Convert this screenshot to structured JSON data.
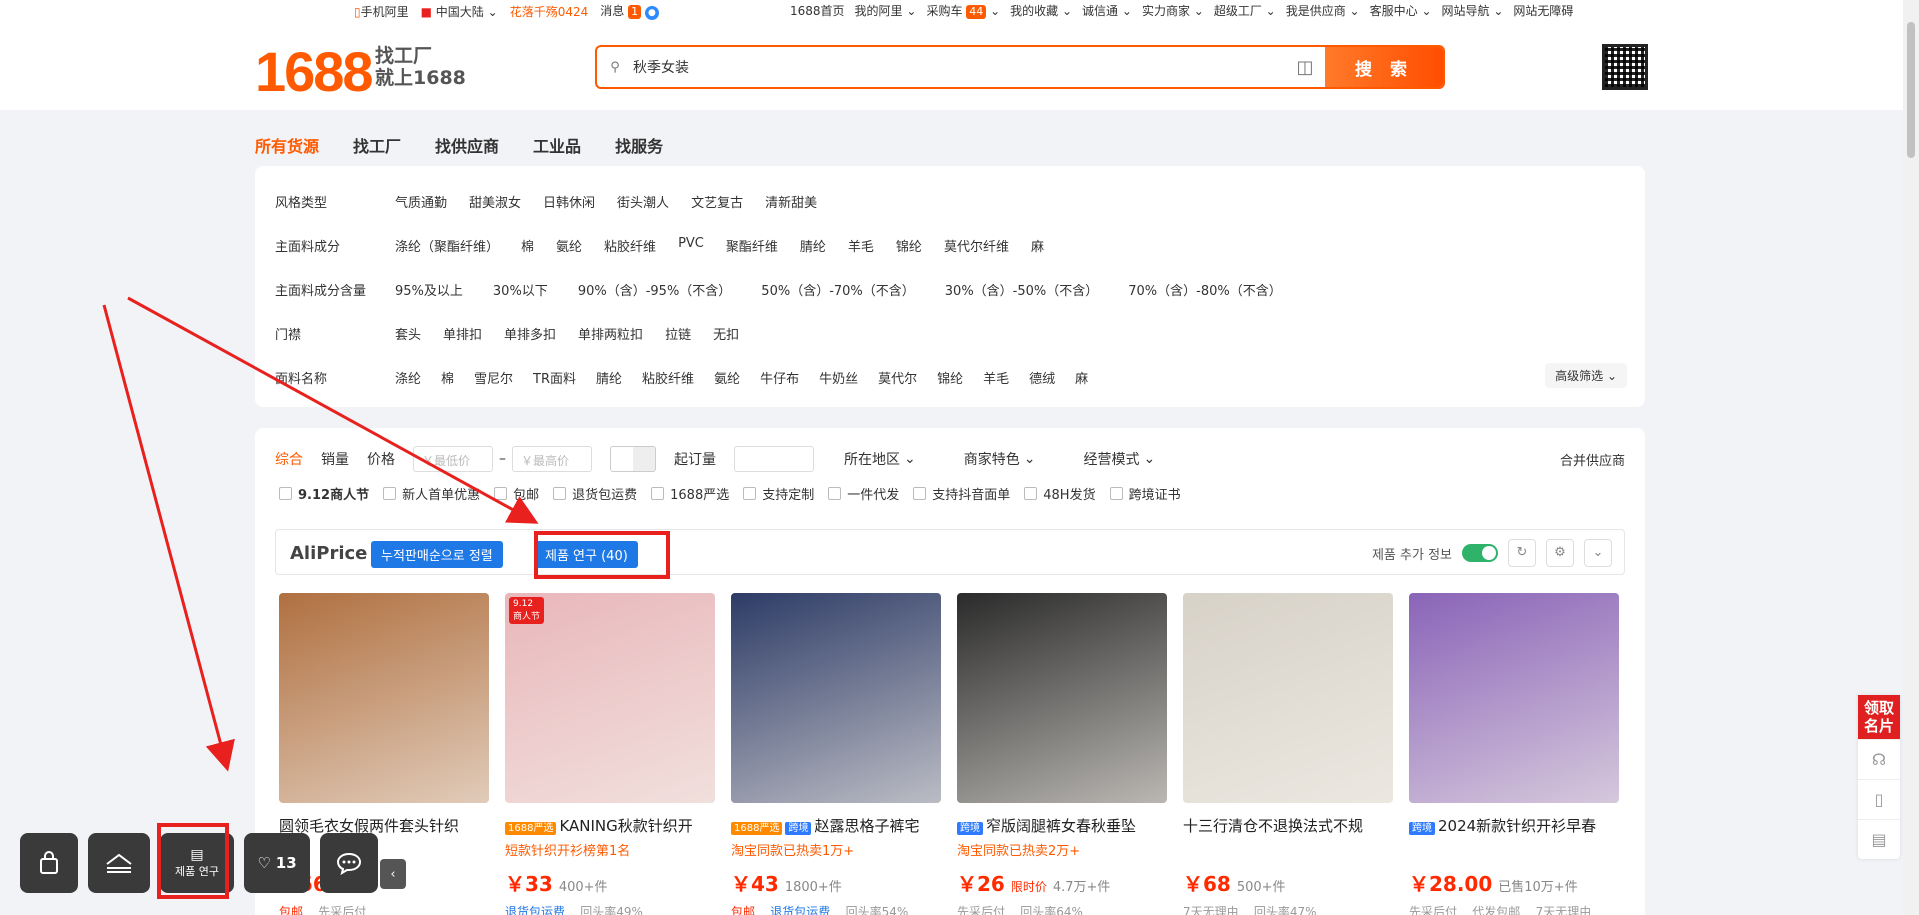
{
  "topbar": {
    "mobile": "手机阿里",
    "region": "中国大陆",
    "promo": "花落千殇0424",
    "messages": "消息",
    "msg_count": "1",
    "links": [
      "1688首页",
      "我的阿里",
      "采购车",
      "我的收藏",
      "诚信通",
      "实力商家",
      "超级工厂",
      "我是供应商",
      "客服中心",
      "网站导航",
      "网站无障碍"
    ],
    "cart_count": "44"
  },
  "logo": {
    "number": "1688",
    "line1": "找工厂",
    "line2": "就上1688"
  },
  "search": {
    "value": "秋季女装",
    "button": "搜 索"
  },
  "nav_tabs": [
    "所有货源",
    "找工厂",
    "找供应商",
    "工业品",
    "找服务"
  ],
  "filters": [
    {
      "label": "风格类型",
      "items": [
        "气质通勤",
        "甜美淑女",
        "日韩休闲",
        "街头潮人",
        "文艺复古",
        "清新甜美"
      ]
    },
    {
      "label": "主面料成分",
      "items": [
        "涤纶（聚酯纤维）",
        "棉",
        "氨纶",
        "粘胶纤维",
        "PVC",
        "聚酯纤维",
        "腈纶",
        "羊毛",
        "锦纶",
        "莫代尔纤维",
        "麻"
      ]
    },
    {
      "label": "主面料成分含量",
      "items": [
        "95%及以上",
        "30%以下",
        "90%（含）-95%（不含）",
        "50%（含）-70%（不含）",
        "30%（含）-50%（不含）",
        "70%（含）-80%（不含）"
      ]
    },
    {
      "label": "门襟",
      "items": [
        "套头",
        "单排扣",
        "单排多扣",
        "单排两粒扣",
        "拉链",
        "无扣"
      ]
    },
    {
      "label": "面料名称",
      "items": [
        "涤纶",
        "棉",
        "雪尼尔",
        "TR面料",
        "腈纶",
        "粘胶纤维",
        "氨纶",
        "牛仔布",
        "牛奶丝",
        "莫代尔",
        "锦纶",
        "羊毛",
        "德绒",
        "麻"
      ]
    }
  ],
  "advanced_filter": "高级筛选",
  "sort": {
    "items": [
      "综合",
      "销量",
      "价格"
    ],
    "min_price": "￥最低价",
    "max_price": "￥最高价",
    "moq": "起订量",
    "dropdowns": [
      "所在地区",
      "商家特色",
      "经营模式"
    ],
    "merge": "合并供应商"
  },
  "checks": [
    "9.12商人节",
    "新人首单优惠",
    "包邮",
    "退货包运费",
    "1688严选",
    "支持定制",
    "一件代发",
    "支持抖音面单",
    "48H发货",
    "跨境证书"
  ],
  "aliprice": {
    "brand": "AliPrice",
    "sort_btn": "누적판매순으로 정렬",
    "research_btn": "제품 연구 (40)",
    "extra_info": "제품 추가 정보"
  },
  "products": [
    {
      "title": "圆领毛衣女假两件套头针织",
      "tags": [],
      "sub": "",
      "price": "￥",
      "price_shown": "56",
      "sold": "件",
      "limited": "",
      "foot": "包邮  先采后付",
      "bg": "#b07040"
    },
    {
      "title": "KANING秋款针织开",
      "tags": [
        "1688严选"
      ],
      "sub": "短款针织开衫榜第1名",
      "price": "￥33",
      "sold": "400+件",
      "limited": "",
      "foot": "退货包运费  回头率49%",
      "bg": "#e9b7bb"
    },
    {
      "title": "赵露思格子裤宅",
      "tags": [
        "1688严选",
        "跨境"
      ],
      "sub": "淘宝同款已热卖1万+",
      "price": "￥43",
      "sold": "1800+件",
      "limited": "",
      "foot": "包邮  退货包运费  回头率54%",
      "bg": "#2d3b66"
    },
    {
      "title": "窄版阔腿裤女春秋垂坠",
      "tags": [
        "跨境"
      ],
      "sub": "淘宝同款已热卖2万+",
      "price": "￥26",
      "sold": "4.7万+件",
      "limited": "限时价",
      "foot": "先采后付  回头率64%",
      "bg": "#2a2a2a"
    },
    {
      "title": "十三行清仓不退换法式不规",
      "tags": [],
      "sub": "",
      "price": "￥68",
      "sold": "500+件",
      "limited": "",
      "foot": "7天无理由  回头率47%",
      "bg": "#d7d2c8"
    },
    {
      "title": "2024新款针织开衫早春",
      "tags": [
        "跨境"
      ],
      "sub": "",
      "price": "￥28.00",
      "sold": "已售10万+件",
      "limited": "",
      "foot": "先采后付  代发包邮  7天无理由",
      "bg": "#8a64b8"
    }
  ],
  "floatbar": {
    "research_label": "제품 연구",
    "likes": "13"
  },
  "rightbar": {
    "card": "领取名片"
  }
}
